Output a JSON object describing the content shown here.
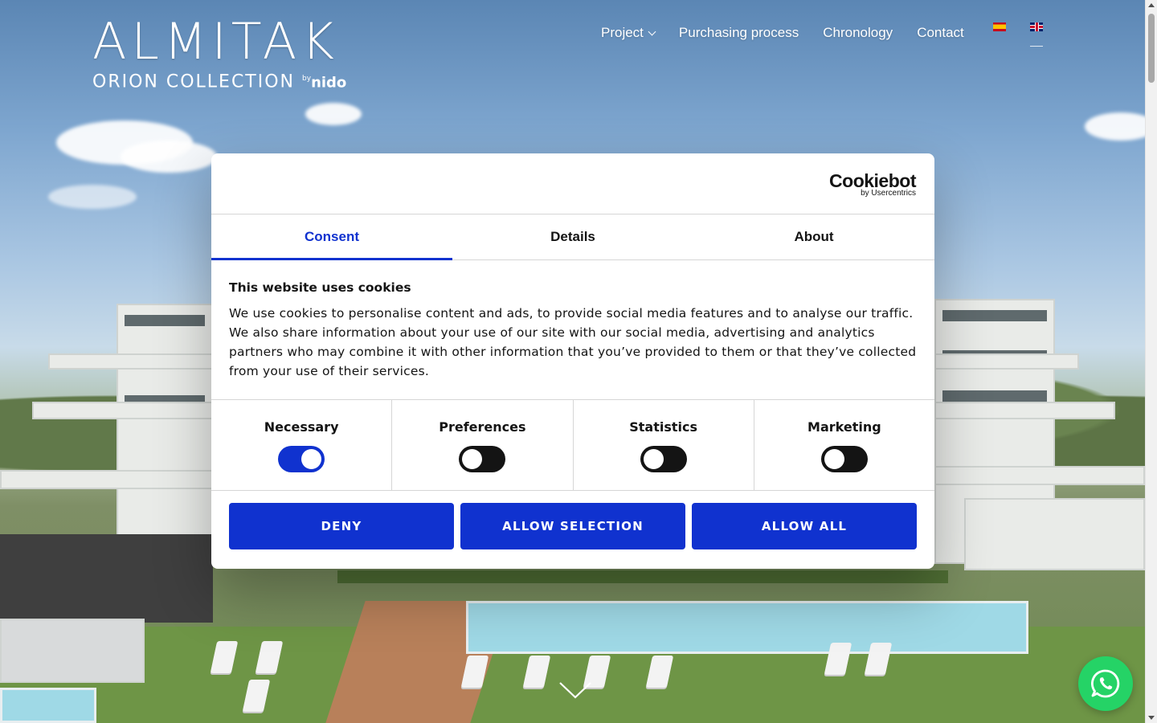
{
  "logo": {
    "main": "ALMITAK",
    "sub": "ORION COLLECTION",
    "by": "by",
    "brand": "nido"
  },
  "nav": {
    "items": [
      {
        "label": "Project",
        "icon": "chevron-down-icon"
      },
      {
        "label": "Purchasing process"
      },
      {
        "label": "Chronology"
      },
      {
        "label": "Contact"
      }
    ],
    "languages": [
      {
        "icon": "flag-es-icon"
      },
      {
        "icon": "flag-en-icon",
        "active": true
      }
    ]
  },
  "cookie_dialog": {
    "brand": {
      "name": "Cookiebot",
      "sub": "by Usercentrics"
    },
    "tabs": [
      {
        "label": "Consent",
        "active": true
      },
      {
        "label": "Details"
      },
      {
        "label": "About"
      }
    ],
    "title": "This website uses cookies",
    "body": "We use cookies to personalise content and ads, to provide social media features and to analyse our traffic. We also share information about your use of our site with our social media, advertising and analytics partners who may combine it with other information that you’ve provided to them or that they’ve collected from your use of their services.",
    "toggles": [
      {
        "label": "Necessary",
        "on": true
      },
      {
        "label": "Preferences",
        "on": false
      },
      {
        "label": "Statistics",
        "on": false
      },
      {
        "label": "Marketing",
        "on": false
      }
    ],
    "buttons": {
      "deny": "DENY",
      "allow_selection": "ALLOW SELECTION",
      "allow_all": "ALLOW ALL"
    },
    "accent_color": "#1032cf"
  },
  "widgets": {
    "scroll_cue_icon": "chevron-down-icon",
    "whatsapp_icon": "whatsapp-icon",
    "whatsapp_color": "#25d366"
  }
}
